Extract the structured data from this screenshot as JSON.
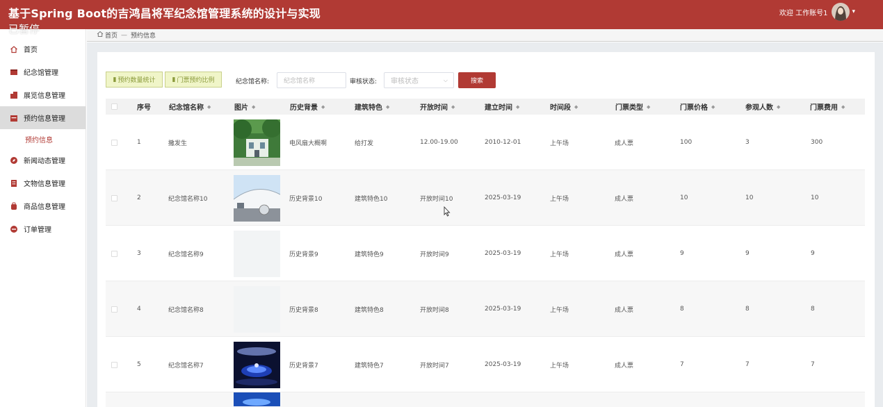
{
  "header": {
    "title": "基于Spring Boot的吉鸿昌将军纪念馆管理系统的设计与实现",
    "paused_overlay": "已暂停",
    "welcome": "欢迎 工作账号1",
    "avatar_icon": "user-avatar-icon",
    "menu_icon": "chevron-down-icon"
  },
  "breadcrumb": {
    "home": "首页",
    "separator": "—",
    "current": "预约信息"
  },
  "sidebar": {
    "items": [
      {
        "label": "首页",
        "icon": "home-icon"
      },
      {
        "label": "纪念馆管理",
        "icon": "tablet-icon"
      },
      {
        "label": "展览信息管理",
        "icon": "buildings-icon"
      },
      {
        "label": "预约信息管理",
        "icon": "calendar-card-icon"
      },
      {
        "label": "新闻动态管理",
        "icon": "compass-icon"
      },
      {
        "label": "文物信息管理",
        "icon": "building-icon"
      },
      {
        "label": "商品信息管理",
        "icon": "bag-icon"
      },
      {
        "label": "订单管理",
        "icon": "minus-circle-icon"
      }
    ],
    "sub_item": "预约信息"
  },
  "toolbar": {
    "btn_count_stats": "预约数量统计",
    "btn_ticket_ratio": "门票预约比例",
    "name_label": "纪念馆名称:",
    "name_placeholder": "纪念馆名称",
    "status_label": "审核状态:",
    "status_placeholder": "审核状态",
    "search_label": "搜索"
  },
  "table": {
    "headers": [
      "序号",
      "纪念馆名称",
      "图片",
      "历史背景",
      "建筑特色",
      "开放时间",
      "建立时间",
      "时间段",
      "门票类型",
      "门票价格",
      "参观人数",
      "门票费用"
    ],
    "rows": [
      {
        "idx": "1",
        "name": "撒发生",
        "image": "tree-house",
        "history": "电风扇大概啊",
        "arch": "给打发",
        "open": "12.00-19.00",
        "built": "2010-12-01",
        "period": "上午场",
        "ticket_type": "成人票",
        "price": "100",
        "visitors": "3",
        "fee": "300"
      },
      {
        "idx": "2",
        "name": "纪念馆名称10",
        "image": "museum-dome",
        "history": "历史背景10",
        "arch": "建筑特色10",
        "open": "开放时间10",
        "built": "2025-03-19",
        "period": "上午场",
        "ticket_type": "成人票",
        "price": "10",
        "visitors": "10",
        "fee": "10"
      },
      {
        "idx": "3",
        "name": "纪念馆名称9",
        "image": "blank",
        "history": "历史背景9",
        "arch": "建筑特色9",
        "open": "开放时间9",
        "built": "2025-03-19",
        "period": "上午场",
        "ticket_type": "成人票",
        "price": "9",
        "visitors": "9",
        "fee": "9"
      },
      {
        "idx": "4",
        "name": "纪念馆名称8",
        "image": "blank",
        "history": "历史背景8",
        "arch": "建筑特色8",
        "open": "开放时间8",
        "built": "2025-03-19",
        "period": "上午场",
        "ticket_type": "成人票",
        "price": "8",
        "visitors": "8",
        "fee": "8"
      },
      {
        "idx": "5",
        "name": "纪念馆名称7",
        "image": "exhibit-hall",
        "history": "历史背景7",
        "arch": "建筑特色7",
        "open": "开放时间7",
        "built": "2025-03-19",
        "period": "上午场",
        "ticket_type": "成人票",
        "price": "7",
        "visitors": "7",
        "fee": "7"
      }
    ]
  },
  "colors": {
    "brand": "#b13a34",
    "stat_button_bg": "#f0f5c8",
    "stat_button_text": "#8a9a3a"
  }
}
